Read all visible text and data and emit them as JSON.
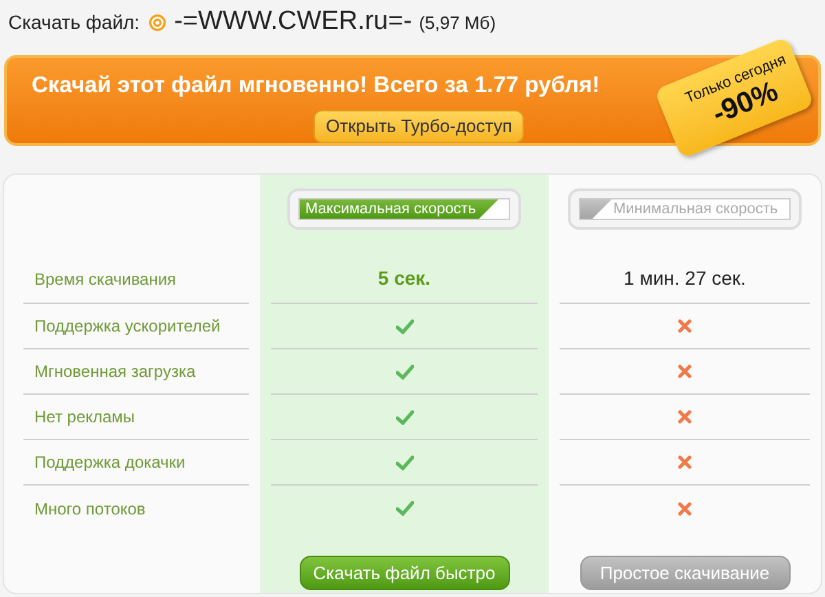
{
  "header": {
    "label": "Скачать файл:",
    "file_name": "-=WWW.CWER.ru=-",
    "size": "(5,97 Мб)"
  },
  "banner": {
    "title": "Скачай этот файл мгновенно! Всего за 1.77 рубля!",
    "button": "Открыть Турбо-доступ",
    "tag": {
      "caption": "Только сегодня",
      "discount": "-90%"
    }
  },
  "comparison": {
    "columns": [
      {
        "kind": "fast",
        "title": "Максимальная скорость",
        "level": 0.95
      },
      {
        "kind": "slow",
        "title": "Минимальная скорость",
        "level": 0.15
      }
    ],
    "rows": [
      {
        "label": "Время скачивания",
        "cells": [
          {
            "kind": "text",
            "text": "5 сек."
          },
          {
            "kind": "text",
            "text": "1 мин. 27 сек."
          }
        ]
      },
      {
        "label": "Поддержка ускорителей",
        "cells": [
          {
            "kind": "check"
          },
          {
            "kind": "cross"
          }
        ]
      },
      {
        "label": "Мгновенная загрузка",
        "cells": [
          {
            "kind": "check"
          },
          {
            "kind": "cross"
          }
        ]
      },
      {
        "label": "Нет рекламы",
        "cells": [
          {
            "kind": "check"
          },
          {
            "kind": "cross"
          }
        ]
      },
      {
        "label": "Поддержка докачки",
        "cells": [
          {
            "kind": "check"
          },
          {
            "kind": "cross"
          }
        ]
      },
      {
        "label": "Много потоков",
        "cells": [
          {
            "kind": "check"
          },
          {
            "kind": "cross"
          }
        ]
      }
    ],
    "buttons": [
      {
        "kind": "fast",
        "label": "Скачать файл быстро"
      },
      {
        "kind": "slow",
        "label": "Простое скачивание"
      }
    ]
  }
}
